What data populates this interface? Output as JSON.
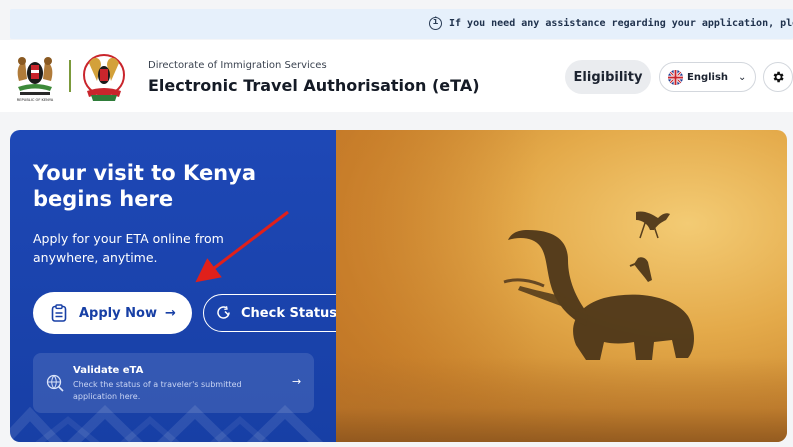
{
  "banner": {
    "text": "If you need any assistance regarding your application, please email",
    "icon": "info-icon"
  },
  "header": {
    "directorate": "Directorate of Immigration Services",
    "title": "Electronic Travel Authorisation (eTA)",
    "coat_of_arms_caption": "REPUBLIC OF KENYA",
    "eligibility_label": "Eligibility",
    "language_label": "English",
    "settings_icon": "gear-icon"
  },
  "hero": {
    "heading": "Your visit to Kenya begins here",
    "subheading": "Apply for your ETA online from anywhere, anytime.",
    "apply_label": "Apply Now",
    "apply_arrow": "→",
    "check_label": "Check Status",
    "check_arrow": "→",
    "validate_title": "Validate eTA",
    "validate_desc": "Check the status of a traveler's submitted application here.",
    "validate_arrow": "→"
  },
  "colors": {
    "brand_blue": "#173fa5",
    "banner_bg": "#e6f0fb",
    "annotation_red": "#e0201b"
  }
}
